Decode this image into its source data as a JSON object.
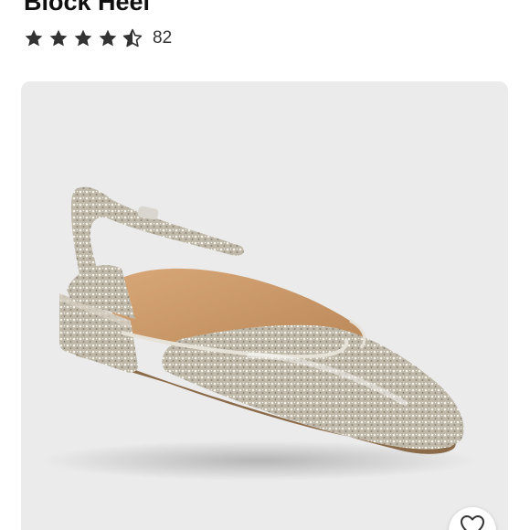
{
  "product": {
    "title": "Block Heel",
    "rating": 4.5,
    "rating_max": 5,
    "review_count": "82"
  },
  "icons": {
    "star": "star-icon",
    "favorite": "heart-icon"
  },
  "colors": {
    "star": "#333333",
    "image_background": "#ebebeb"
  }
}
